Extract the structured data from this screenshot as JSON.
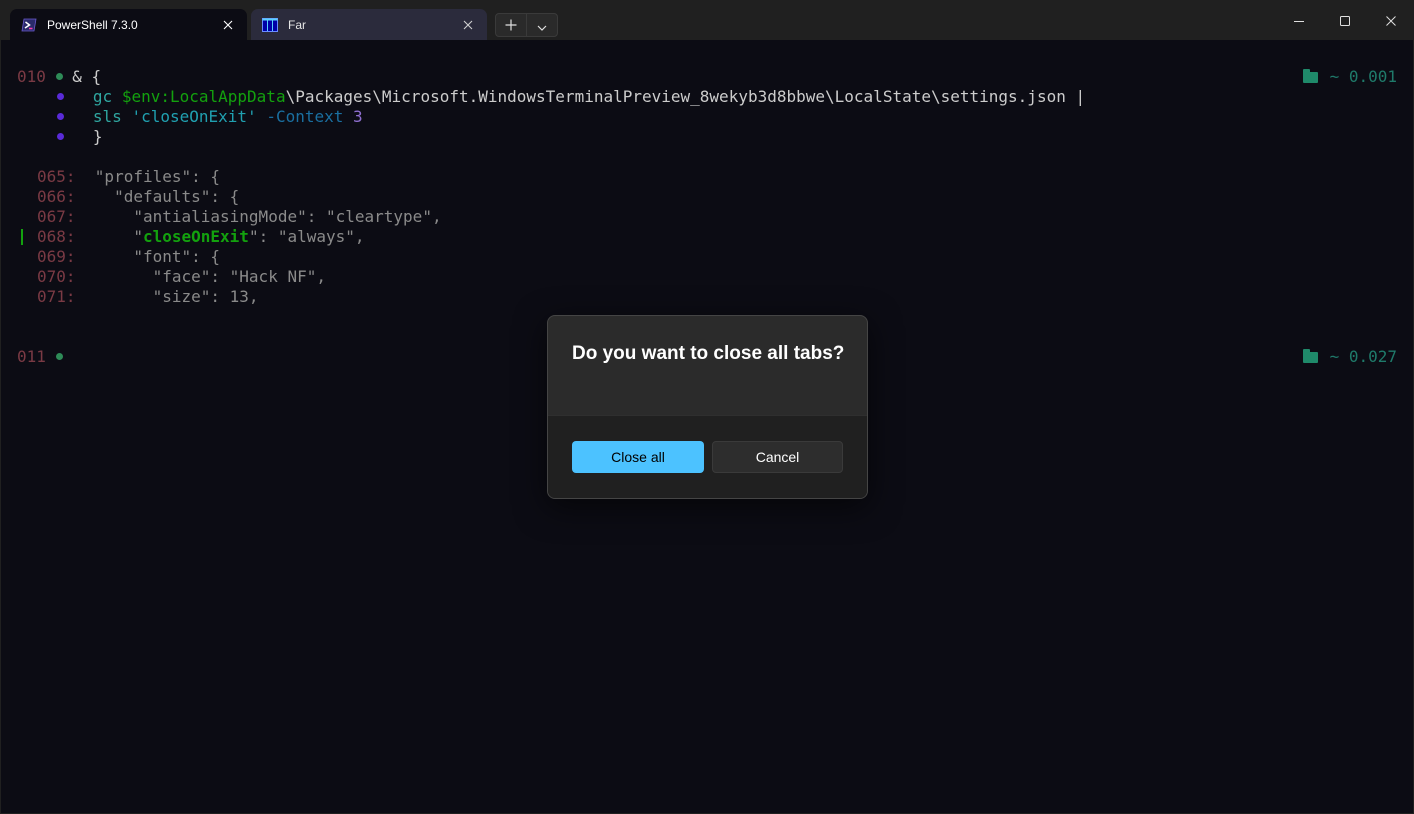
{
  "tabs": [
    {
      "title": "PowerShell 7.3.0",
      "icon": "powershell-icon",
      "active": true
    },
    {
      "title": "Far",
      "icon": "far-manager-icon",
      "active": false
    }
  ],
  "tab_controls": {
    "new_tab_icon": "plus-icon",
    "dropdown_icon": "chevron-down-icon"
  },
  "window_controls": {
    "minimize_icon": "minimize-icon",
    "maximize_icon": "maximize-icon",
    "close_icon": "close-icon"
  },
  "terminal": {
    "prompt1": {
      "number": "010",
      "open": "& {",
      "duration": "~ 0.001"
    },
    "cmd_line1": {
      "cmd": "gc",
      "var": "$env:LocalAppData",
      "path": "\\Packages\\Microsoft.WindowsTerminalPreview_8wekyb3d8bbwe\\LocalState\\settings.json",
      "pipe": "|"
    },
    "cmd_line2": {
      "cmd": "sls",
      "arg": "'closeOnExit'",
      "param": "-Context",
      "num": "3"
    },
    "cmd_line3": {
      "close": "}"
    },
    "output": [
      {
        "lnum": "065:",
        "text": "\"profiles\": {"
      },
      {
        "lnum": "066:",
        "text": "  \"defaults\": {"
      },
      {
        "lnum": "067:",
        "text": "    \"antialiasingMode\": \"cleartype\","
      },
      {
        "lnum": "068:",
        "pre": "    \"",
        "match": "closeOnExit",
        "post": "\": \"always\","
      },
      {
        "lnum": "069:",
        "text": "    \"font\": {"
      },
      {
        "lnum": "070:",
        "text": "      \"face\": \"Hack NF\","
      },
      {
        "lnum": "071:",
        "text": "      \"size\": 13,"
      }
    ],
    "prompt2": {
      "number": "011",
      "duration": "~ 0.027"
    }
  },
  "dialog": {
    "title": "Do you want to close all tabs?",
    "primary_label": "Close all",
    "secondary_label": "Cancel"
  },
  "colors": {
    "accent": "#4cc2ff",
    "terminal_bg": "#0c0c14",
    "match": "#13a10e"
  }
}
